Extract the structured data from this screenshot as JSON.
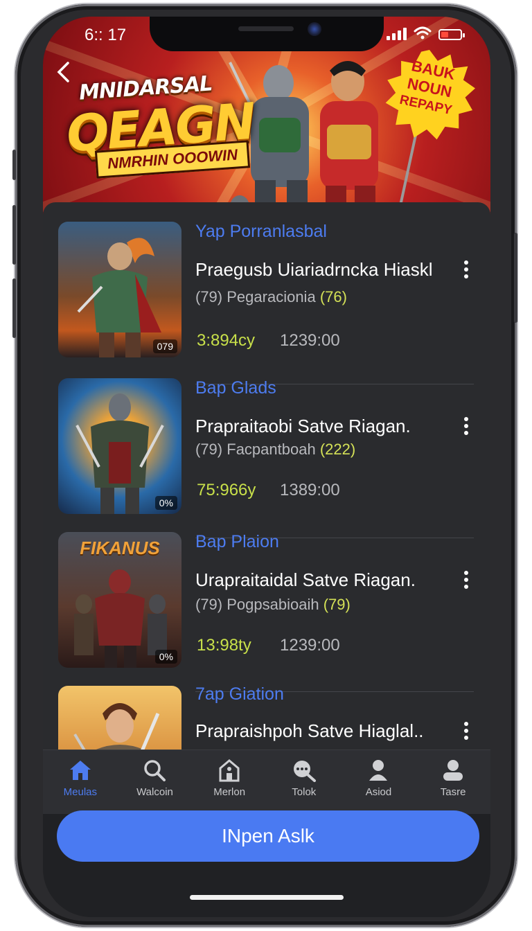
{
  "status_bar": {
    "time": "6:: 17"
  },
  "banner": {
    "title_top": "MNIDARSAL",
    "title_main": "QEAGN",
    "title_sub": "NMRHIN OOOWIN",
    "badge_lines": [
      "BAUK",
      "NOUN",
      "REPAPY"
    ],
    "back_icon": "chevron-left-icon"
  },
  "list": {
    "items": [
      {
        "title": "Yap Porranlasbal",
        "name": "Praegusb Uiariadrncka Hiaskl",
        "meta_open": "(79)",
        "meta_text": "Pegaracionia",
        "meta_count": "(76)",
        "price": "3:894cy",
        "time": "1239:00",
        "thumb_tag": "079"
      },
      {
        "title": "Bap Glads",
        "name": "Prapraitaobi Satve Riagan.",
        "meta_open": "(79)",
        "meta_text": "Facpantboah",
        "meta_count": "(222)",
        "price": "75:966y",
        "time": "1389:00",
        "thumb_tag": "0%"
      },
      {
        "title": "Bap Plaion",
        "name": "Uraprаitаidal Satve Riagan.",
        "meta_open": "(79)",
        "meta_text": "Pogpsabioaih",
        "meta_count": "(79)",
        "price": "13:98ty",
        "time": "1239:00",
        "thumb_tag": "0%",
        "thumb_caption": "FIKANUS"
      },
      {
        "title": "7ap Giation",
        "name": "Prapraishpoh Satve Hiaglal.."
      }
    ]
  },
  "nav": {
    "items": [
      {
        "label": "Meulas",
        "icon": "home-icon",
        "active": true
      },
      {
        "label": "Walcoin",
        "icon": "search-icon",
        "active": false
      },
      {
        "label": "Merlon",
        "icon": "building-icon",
        "active": false
      },
      {
        "label": "Tolok",
        "icon": "chat-search-icon",
        "active": false
      },
      {
        "label": "Asiod",
        "icon": "user-icon",
        "active": false
      },
      {
        "label": "Tasre",
        "icon": "profile-icon",
        "active": false
      }
    ]
  },
  "cta": {
    "label": "INpen Aslk"
  },
  "colors": {
    "accent": "#4a7af2",
    "price": "#c8e04a",
    "background": "#2a2b2e"
  }
}
